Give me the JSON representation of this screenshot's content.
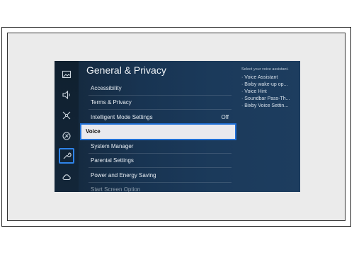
{
  "screen": {
    "title": "General & Privacy",
    "menu_items": [
      {
        "label": "Accessibility",
        "value": ""
      },
      {
        "label": "Terms & Privacy",
        "value": ""
      },
      {
        "label": "Intelligent Mode Settings",
        "value": "Off"
      },
      {
        "label": "Voice",
        "value": "",
        "selected": true
      },
      {
        "label": "System Manager",
        "value": ""
      },
      {
        "label": "Parental Settings",
        "value": ""
      },
      {
        "label": "Power and Energy Saving",
        "value": ""
      },
      {
        "label": "Start Screen Option",
        "value": ""
      }
    ],
    "assistant_panel": {
      "header": "Select your voice assistant.",
      "options": [
        "Voice Assistant",
        "Bixby wake-up op...",
        "Voice Hint",
        "Soundbar Pass-Th...",
        "Bixby Voice Settin..."
      ]
    },
    "sidebar_icons": [
      "picture-icon",
      "sound-icon",
      "connection-icon",
      "support-icon",
      "general-icon",
      "cloud-icon"
    ],
    "active_sidebar": "general-icon",
    "colors": {
      "accent": "#1f6fd6",
      "background": "#1b3a5b",
      "selected_bg": "#e9e9ee"
    }
  }
}
